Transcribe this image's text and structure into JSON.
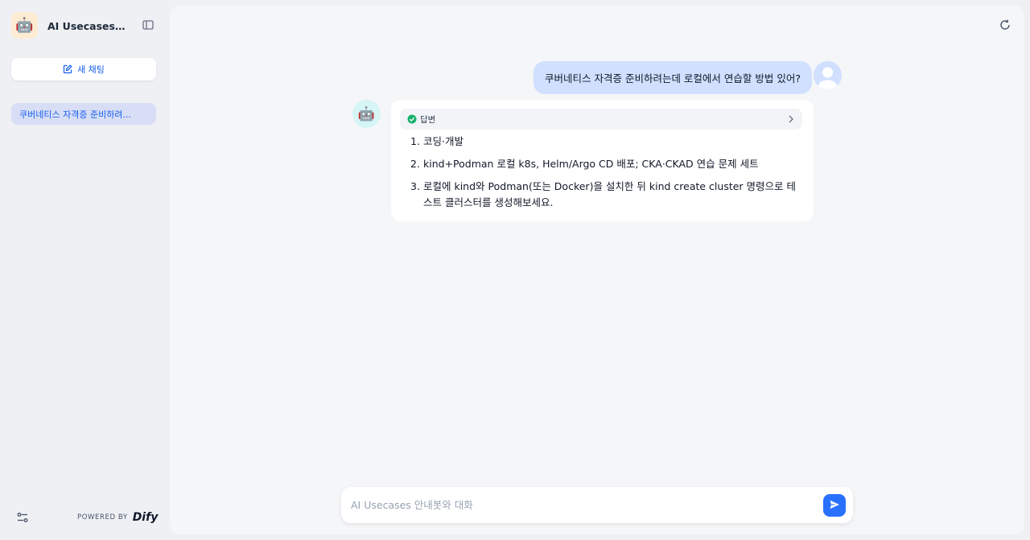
{
  "sidebar": {
    "app_title": "AI Usecases 안…",
    "new_chat_label": "새 채팅",
    "conversations": [
      {
        "label": "쿠버네티스 자격증 준비하려..."
      }
    ],
    "powered_label": "POWERED BY",
    "brand": "Dify"
  },
  "chat": {
    "user_message": "쿠버네티스 자격증 준비하려는데 로컬에서 연습할 방법 있어?",
    "answer_tag": "답변",
    "answer_items": [
      {
        "num": "1.",
        "text": "코딩·개발"
      },
      {
        "num": "2.",
        "text": "kind+Podman 로컬 k8s, Helm/Argo CD 배포; CKA·CKAD 연습 문제 세트"
      },
      {
        "num": "3.",
        "text": "로컬에 kind와 Podman(또는 Docker)을 설치한 뒤 kind create cluster 명령으로 테스트 클러스터를 생성해보세요."
      }
    ]
  },
  "input": {
    "placeholder": "AI Usecases 안내봇와 대화",
    "value": ""
  },
  "icons": {
    "app": "robot-icon",
    "toggle": "sidebar-toggle-icon",
    "new_chat": "edit-icon",
    "settings": "sliders-icon",
    "reset": "refresh-icon",
    "check": "check-circle-icon",
    "chevron": "chevron-right-icon",
    "send": "send-icon"
  },
  "colors": {
    "accent": "#155eef",
    "send_button": "#2970ff",
    "user_bubble": "#d1e0ff",
    "check_green": "#17b26a"
  }
}
